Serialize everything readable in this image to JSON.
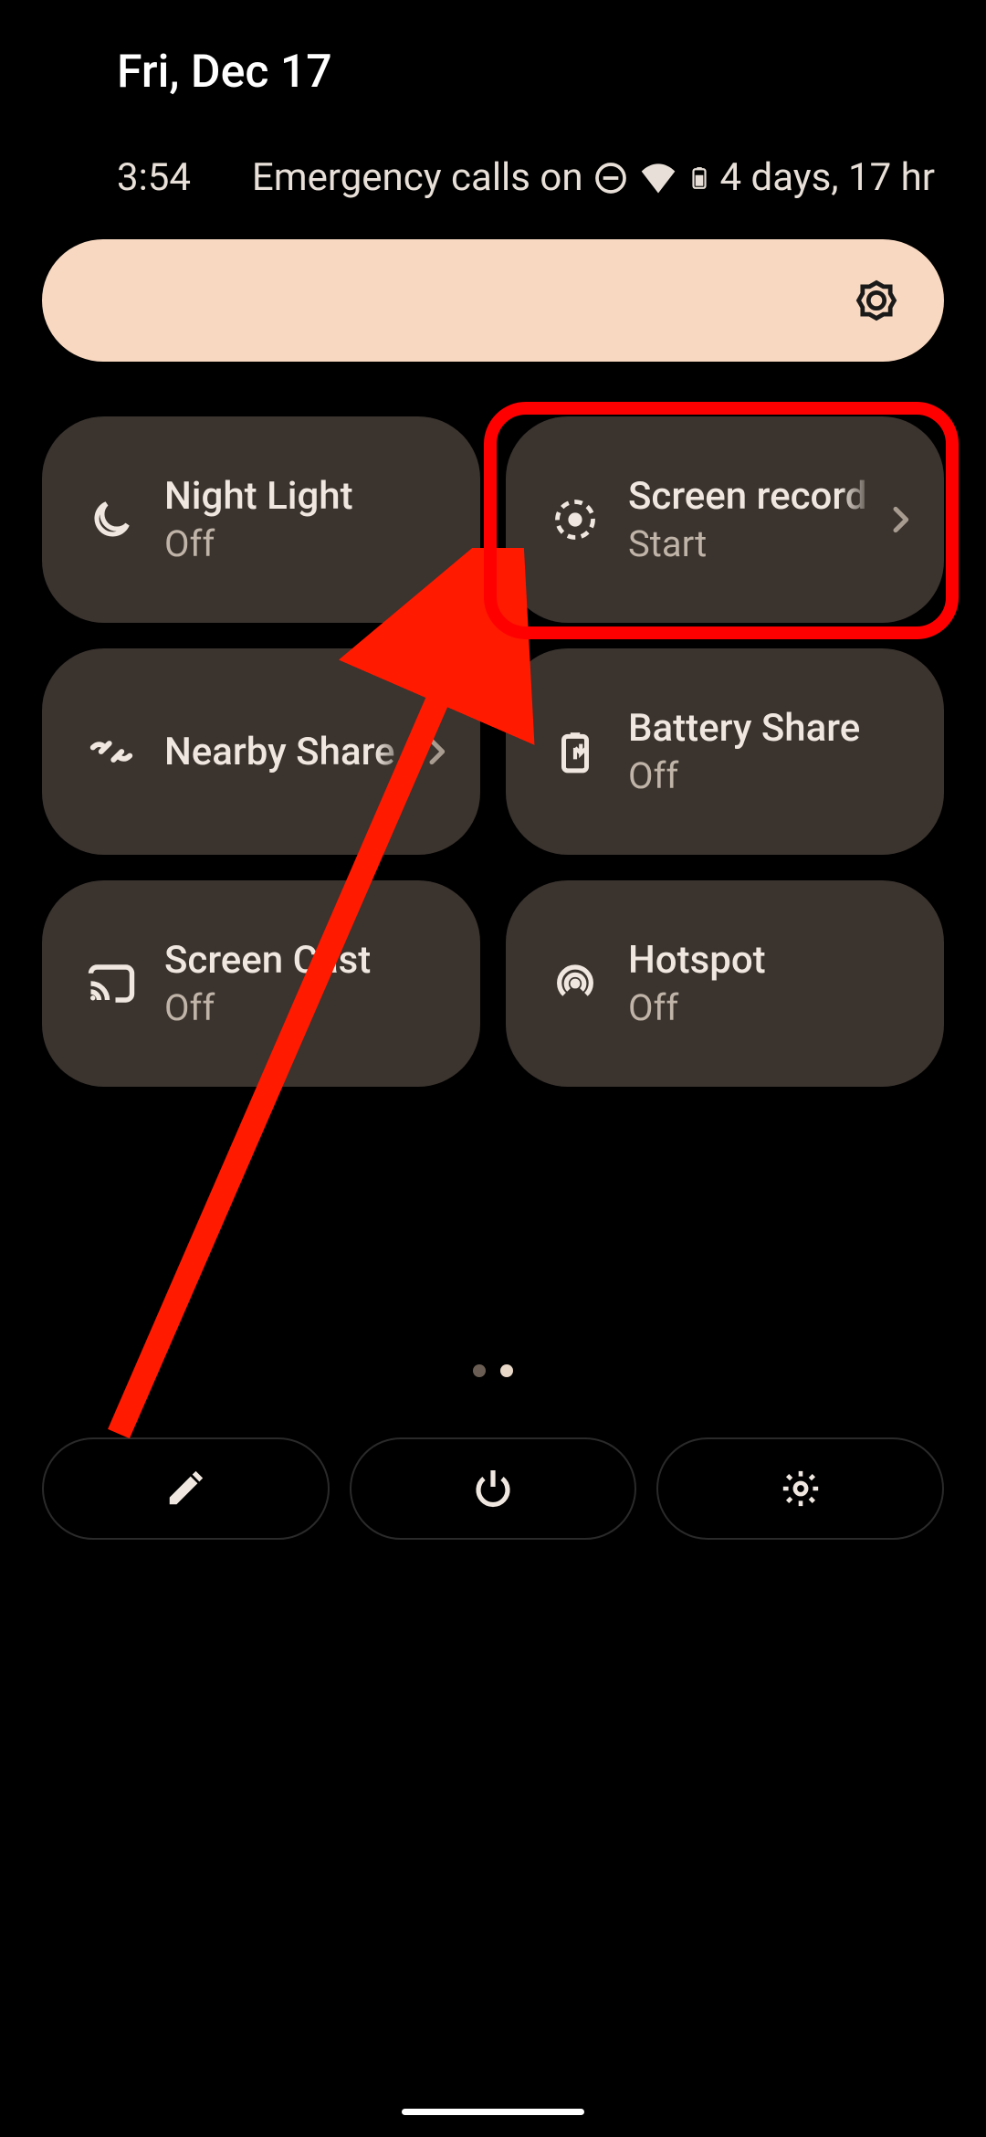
{
  "date": "Fri, Dec 17",
  "status": {
    "time": "3:54",
    "text": "Emergency calls on",
    "battery_estimate": "4 days, 17 hr"
  },
  "tiles": [
    {
      "label": "Night Light",
      "sub": "Off",
      "chevron": false
    },
    {
      "label": "Screen record",
      "sub": "Start",
      "chevron": true
    },
    {
      "label": "Nearby Share",
      "sub": "",
      "chevron": true
    },
    {
      "label": "Battery Share",
      "sub": "Off",
      "chevron": false
    },
    {
      "label": "Screen Cast",
      "sub": "Off",
      "chevron": false
    },
    {
      "label": "Hotspot",
      "sub": "Off",
      "chevron": false
    }
  ],
  "pagination": {
    "count": 2,
    "active": 1
  },
  "colors": {
    "tile_bg": "#3a332e",
    "brightness_bg": "#f8d8c0",
    "highlight": "#ff0000",
    "text_primary": "#f0e8e0",
    "text_secondary": "#c0b4a8"
  }
}
